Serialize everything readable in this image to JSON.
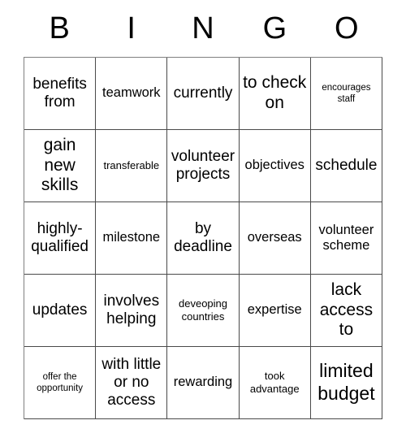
{
  "card": {
    "header_letters": [
      "B",
      "I",
      "N",
      "G",
      "O"
    ],
    "columns": 5,
    "rows": 5,
    "colors": {
      "background": "#ffffff",
      "text": "#000000",
      "border": "#4a4a4a"
    },
    "cells": [
      [
        {
          "text": "benefits from",
          "size": "l"
        },
        {
          "text": "teamwork",
          "size": "m"
        },
        {
          "text": "currently",
          "size": "l"
        },
        {
          "text": "to check on",
          "size": "xl"
        },
        {
          "text": "encourages staff",
          "size": "xs"
        }
      ],
      [
        {
          "text": "gain new skills",
          "size": "xl"
        },
        {
          "text": "transferable",
          "size": "s"
        },
        {
          "text": "volunteer projects",
          "size": "l"
        },
        {
          "text": "objectives",
          "size": "m"
        },
        {
          "text": "schedule",
          "size": "l"
        }
      ],
      [
        {
          "text": "highly-qualified",
          "size": "l"
        },
        {
          "text": "milestone",
          "size": "m"
        },
        {
          "text": "by deadline",
          "size": "l"
        },
        {
          "text": "overseas",
          "size": "m"
        },
        {
          "text": "volunteer scheme",
          "size": "m"
        }
      ],
      [
        {
          "text": "updates",
          "size": "l"
        },
        {
          "text": "involves helping",
          "size": "l"
        },
        {
          "text": "deveoping countries",
          "size": "s"
        },
        {
          "text": "expertise",
          "size": "m"
        },
        {
          "text": "lack access to",
          "size": "xl"
        }
      ],
      [
        {
          "text": "offer the opportunity",
          "size": "xs"
        },
        {
          "text": "with little or no access",
          "size": "l"
        },
        {
          "text": "rewarding",
          "size": "m"
        },
        {
          "text": "took advantage",
          "size": "s"
        },
        {
          "text": "limited budget",
          "size": "xxl"
        }
      ]
    ]
  }
}
